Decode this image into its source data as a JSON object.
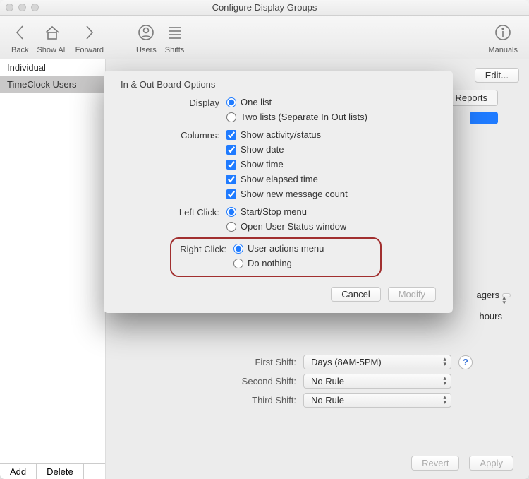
{
  "window": {
    "title": "Configure Display Groups"
  },
  "toolbar": {
    "back": "Back",
    "showall": "Show All",
    "forward": "Forward",
    "users": "Users",
    "shifts": "Shifts",
    "manuals": "Manuals"
  },
  "sidebar": {
    "items": [
      "Individual",
      "TimeClock Users"
    ],
    "add": "Add",
    "delete": "Delete"
  },
  "content": {
    "edit": "Edit...",
    "tab_reports": "Reports",
    "first_shift_label": "First Shift:",
    "first_shift_value": "Days (8AM-5PM)",
    "second_shift_label": "Second Shift:",
    "second_shift_value": "No Rule",
    "third_shift_label": "Third Shift:",
    "third_shift_value": "No Rule",
    "peek_agers": "agers",
    "peek_hours": "hours",
    "revert": "Revert",
    "apply": "Apply"
  },
  "sheet": {
    "title": "In & Out Board Options",
    "display_label": "Display",
    "display_one": "One list",
    "display_two": "Two lists  (Separate In  Out lists)",
    "columns_label": "Columns:",
    "col_activity": "Show activity/status",
    "col_date": "Show date",
    "col_time": "Show time",
    "col_elapsed": "Show elapsed time",
    "col_msgcount": "Show new message count",
    "left_label": "Left Click:",
    "left_startstop": "Start/Stop menu",
    "left_openstatus": "Open User Status window",
    "right_label": "Right Click:",
    "right_actions": "User actions menu",
    "right_nothing": "Do nothing",
    "cancel": "Cancel",
    "modify": "Modify"
  }
}
